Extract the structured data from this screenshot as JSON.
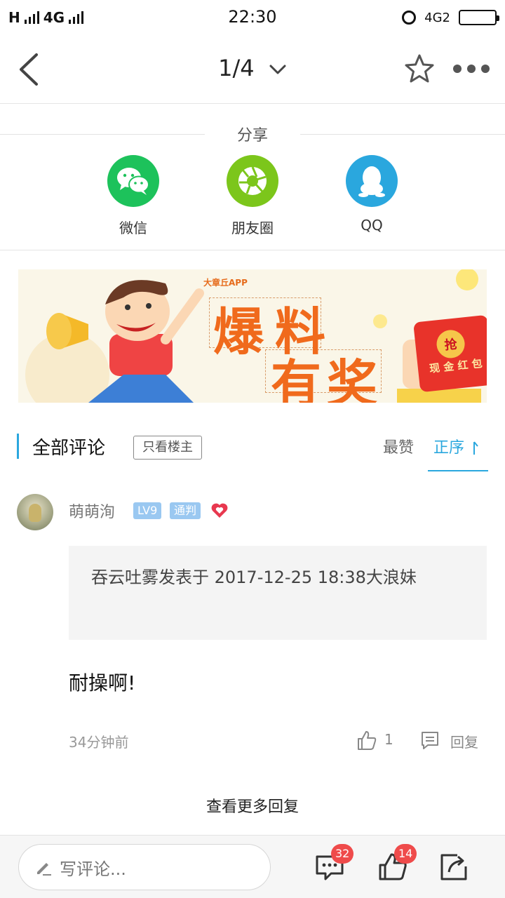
{
  "status_bar": {
    "network_left": "H",
    "network_type": "4G",
    "time": "22:30",
    "network_right": "4G2"
  },
  "nav": {
    "page_indicator": "1/4",
    "icons": [
      "back-icon",
      "chevron-down-icon",
      "star-icon",
      "more-icon"
    ]
  },
  "share": {
    "title": "分享",
    "items": [
      {
        "label": "微信",
        "icon": "wechat-icon",
        "color": "#1dc25b"
      },
      {
        "label": "朋友圈",
        "icon": "moments-icon",
        "color": "#7cc61b"
      },
      {
        "label": "QQ",
        "icon": "qq-icon",
        "color": "#2aa7de"
      }
    ]
  },
  "banner": {
    "app_name": "大章丘APP",
    "headline_1": "爆",
    "headline_2": "料",
    "headline_3": "有",
    "headline_4": "奖",
    "redpack_grab": "抢",
    "redpack_text": "现 金 红 包"
  },
  "comments_header": {
    "title": "全部评论",
    "owner_filter": "只看楼主",
    "tab_best": "最赞",
    "tab_order": "正序"
  },
  "comment": {
    "username": "萌萌洵",
    "level_badge": "LV9",
    "title_badge": "通判",
    "quote": "吞云吐雾发表于 2017-12-25 18:38大浪妹",
    "text": "耐操啊!",
    "time": "34分钟前",
    "like_count": "1",
    "reply_label": "回复"
  },
  "more_replies": "查看更多回复",
  "bottom_bar": {
    "input_placeholder": "写评论...",
    "comment_count": "32",
    "like_count": "14"
  },
  "colors": {
    "accent": "#2aa7de",
    "badge_red": "#ef4b4b",
    "wechat_green": "#1dc25b",
    "moments_green": "#7cc61b"
  }
}
